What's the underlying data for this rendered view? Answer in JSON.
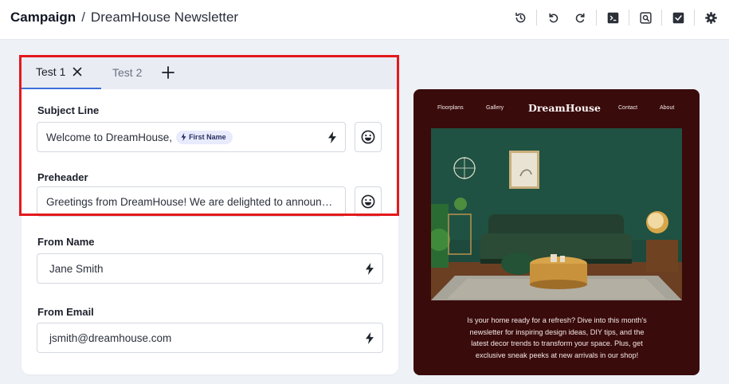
{
  "breadcrumb": {
    "root": "Campaign",
    "separator": "/",
    "page": "DreamHouse Newsletter"
  },
  "toolbar": {
    "icons": [
      "history-icon",
      "undo-icon",
      "redo-icon",
      "terminal-icon",
      "preview-icon",
      "save-icon",
      "settings-icon"
    ]
  },
  "tabs": [
    {
      "label": "Test 1",
      "active": true
    },
    {
      "label": "Test 2",
      "active": false
    }
  ],
  "form": {
    "subject": {
      "label": "Subject Line",
      "value": "Welcome to DreamHouse,",
      "token": "First Name"
    },
    "preheader": {
      "label": "Preheader",
      "value": "Greetings from DreamHouse! We are delighted to announce..."
    },
    "from_name": {
      "label": "From Name",
      "value": "Jane Smith"
    },
    "from_email": {
      "label": "From Email",
      "value": "jsmith@dreamhouse.com"
    }
  },
  "preview": {
    "nav": {
      "floorplans": "Floorplans",
      "gallery": "Gallery",
      "logo": "DreamHouse",
      "contact": "Contact",
      "about": "About"
    },
    "body_lines": [
      "Is your home ready for a refresh? Dive into this month's",
      "newsletter for inspiring design ideas, DIY tips, and the",
      "latest decor trends to transform your space. Plus, get",
      "exclusive sneak peeks at new arrivals in our shop!"
    ]
  },
  "colors": {
    "accent": "#3d6fd8",
    "highlight": "#e3191c",
    "preview_bg": "#3a0b0b",
    "token_bg": "#e8ebfd"
  }
}
